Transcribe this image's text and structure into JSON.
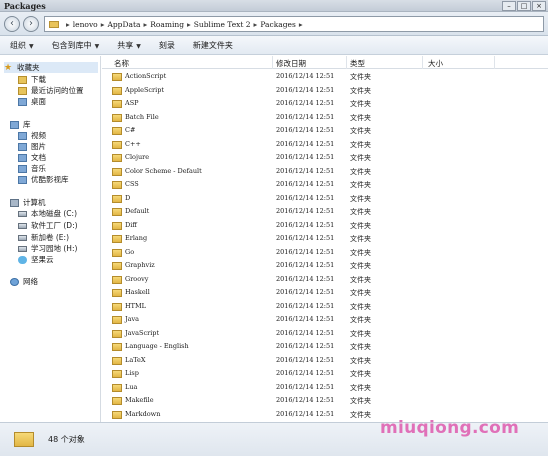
{
  "window": {
    "title": "Packages"
  },
  "address": {
    "crumbs": [
      "lenovo",
      "AppData",
      "Roaming",
      "Sublime Text 2",
      "Packages"
    ],
    "separator": "▸"
  },
  "toolbar": {
    "organize": "组织",
    "include_library": "包含到库中",
    "share": "共享",
    "burn": "刻录",
    "new_folder": "新建文件夹"
  },
  "nav": {
    "favorites": "收藏夹",
    "downloads": "下载",
    "recent": "最近访问的位置",
    "desktop": "桌面",
    "libraries": "库",
    "videos": "视频",
    "pictures": "图片",
    "documents": "文档",
    "music": "音乐",
    "youku": "优酷影视库",
    "computer": "计算机",
    "drive_c": "本地磁盘 (C:)",
    "drive_d": "软件工厂 (D:)",
    "drive_e": "新加卷 (E:)",
    "drive_h": "学习园地 (H:)",
    "cloud": "坚果云",
    "network": "网络"
  },
  "columns": {
    "name": "名称",
    "date": "修改日期",
    "type": "类型",
    "size": "大小"
  },
  "files": [
    {
      "name": "ActionScript",
      "date": "2016/12/14 12:51",
      "type": "文件夹"
    },
    {
      "name": "AppleScript",
      "date": "2016/12/14 12:51",
      "type": "文件夹"
    },
    {
      "name": "ASP",
      "date": "2016/12/14 12:51",
      "type": "文件夹"
    },
    {
      "name": "Batch File",
      "date": "2016/12/14 12:51",
      "type": "文件夹"
    },
    {
      "name": "C#",
      "date": "2016/12/14 12:51",
      "type": "文件夹"
    },
    {
      "name": "C++",
      "date": "2016/12/14 12:51",
      "type": "文件夹"
    },
    {
      "name": "Clojure",
      "date": "2016/12/14 12:51",
      "type": "文件夹"
    },
    {
      "name": "Color Scheme - Default",
      "date": "2016/12/14 12:51",
      "type": "文件夹"
    },
    {
      "name": "CSS",
      "date": "2016/12/14 12:51",
      "type": "文件夹"
    },
    {
      "name": "D",
      "date": "2016/12/14 12:51",
      "type": "文件夹"
    },
    {
      "name": "Default",
      "date": "2016/12/14 12:51",
      "type": "文件夹"
    },
    {
      "name": "Diff",
      "date": "2016/12/14 12:51",
      "type": "文件夹"
    },
    {
      "name": "Erlang",
      "date": "2016/12/14 12:51",
      "type": "文件夹"
    },
    {
      "name": "Go",
      "date": "2016/12/14 12:51",
      "type": "文件夹"
    },
    {
      "name": "Graphviz",
      "date": "2016/12/14 12:51",
      "type": "文件夹"
    },
    {
      "name": "Groovy",
      "date": "2016/12/14 12:51",
      "type": "文件夹"
    },
    {
      "name": "Haskell",
      "date": "2016/12/14 12:51",
      "type": "文件夹"
    },
    {
      "name": "HTML",
      "date": "2016/12/14 12:51",
      "type": "文件夹"
    },
    {
      "name": "Java",
      "date": "2016/12/14 12:51",
      "type": "文件夹"
    },
    {
      "name": "JavaScript",
      "date": "2016/12/14 12:51",
      "type": "文件夹"
    },
    {
      "name": "Language - English",
      "date": "2016/12/14 12:51",
      "type": "文件夹"
    },
    {
      "name": "LaTeX",
      "date": "2016/12/14 12:51",
      "type": "文件夹"
    },
    {
      "name": "Lisp",
      "date": "2016/12/14 12:51",
      "type": "文件夹"
    },
    {
      "name": "Lua",
      "date": "2016/12/14 12:51",
      "type": "文件夹"
    },
    {
      "name": "Makefile",
      "date": "2016/12/14 12:51",
      "type": "文件夹"
    },
    {
      "name": "Markdown",
      "date": "2016/12/14 12:51",
      "type": "文件夹"
    }
  ],
  "status": {
    "count": "48 个对象"
  },
  "watermark": "miuqiong.com",
  "icons": {
    "folder": "folder-icon",
    "favorites": "star-icon",
    "library": "library-icon",
    "computer": "computer-icon",
    "drive": "drive-icon",
    "network": "network-icon",
    "cloud": "cloud-icon"
  }
}
